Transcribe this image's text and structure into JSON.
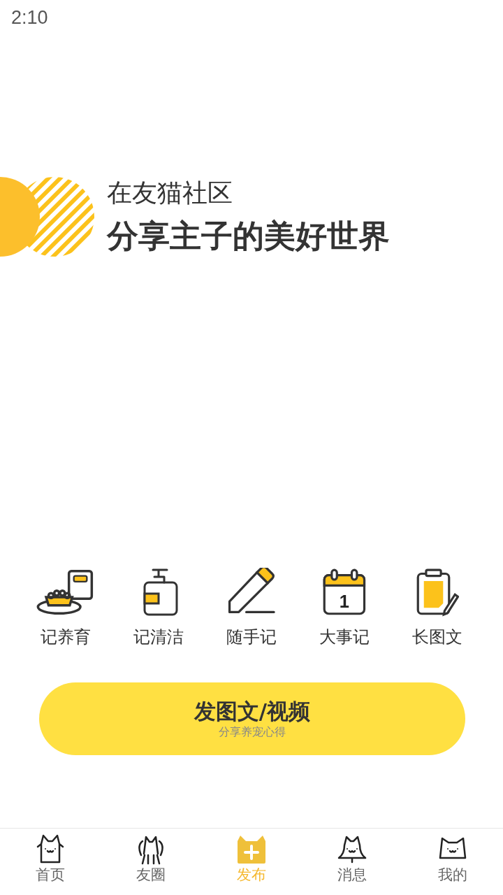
{
  "status_bar": {
    "time": "2:10"
  },
  "hero": {
    "title": "在友猫社区",
    "headline": "分享主子的美好世界"
  },
  "features": [
    {
      "kind": "feeding",
      "label": "记养育"
    },
    {
      "kind": "cleaning",
      "label": "记清洁"
    },
    {
      "kind": "note",
      "label": "随手记"
    },
    {
      "kind": "event",
      "label": "大事记",
      "icon_text": "1"
    },
    {
      "kind": "longpost",
      "label": "长图文"
    }
  ],
  "publish_button": {
    "title": "发图文/视频",
    "subtitle": "分享养宠心得"
  },
  "tab_bar": [
    {
      "kind": "home",
      "label": "首页",
      "selected": false
    },
    {
      "kind": "circle",
      "label": "友圈",
      "selected": false
    },
    {
      "kind": "publish",
      "label": "发布",
      "selected": true
    },
    {
      "kind": "messages",
      "label": "消息",
      "selected": false
    },
    {
      "kind": "profile",
      "label": "我的",
      "selected": false
    }
  ]
}
